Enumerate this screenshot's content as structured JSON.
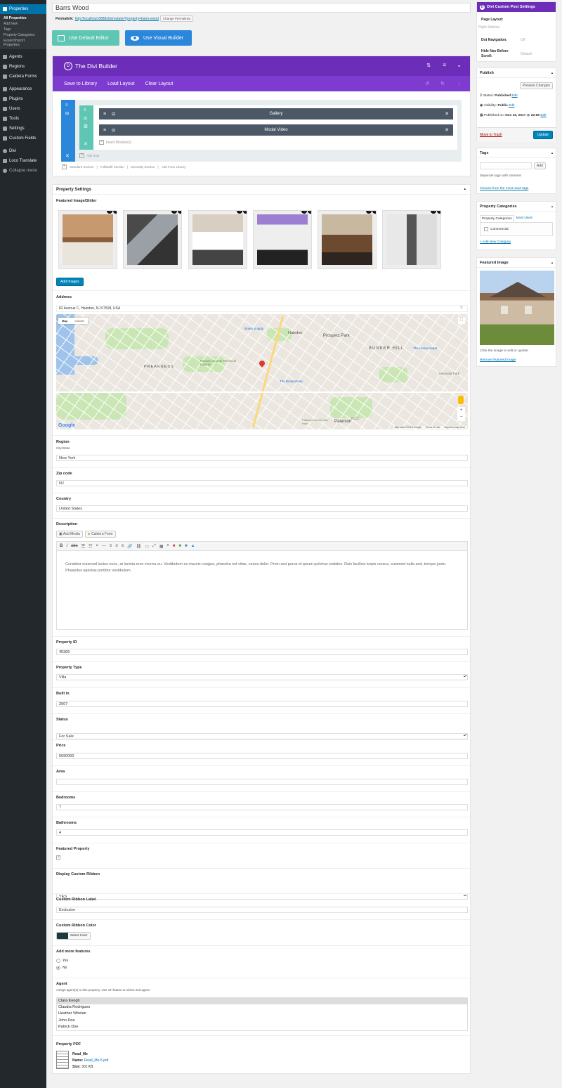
{
  "sidebar": {
    "items": [
      {
        "label": "Properties",
        "icon": "home-icon"
      },
      {
        "label": "Agents",
        "icon": "user-icon"
      },
      {
        "label": "Regions",
        "icon": "location-icon"
      },
      {
        "label": "Caldera Forms",
        "icon": "form-icon"
      },
      {
        "label": "Appearance",
        "icon": "brush-icon"
      },
      {
        "label": "Plugins",
        "icon": "plug-icon"
      },
      {
        "label": "Users",
        "icon": "users-icon"
      },
      {
        "label": "Tools",
        "icon": "wrench-icon"
      },
      {
        "label": "Settings",
        "icon": "settings-icon"
      },
      {
        "label": "Custom Fields",
        "icon": "gear-icon"
      },
      {
        "label": "Divi",
        "icon": "divi-icon"
      },
      {
        "label": "Loco Translate",
        "icon": "translate-icon"
      },
      {
        "label": "Collapse menu",
        "icon": "collapse-icon"
      }
    ],
    "submenu": [
      "All Properties",
      "Add New",
      "Tags",
      "Property Categories",
      "Export/Import Properties"
    ]
  },
  "post": {
    "title": "Barrs Wood",
    "permalink_label": "Permalink:",
    "permalink_url": "http://localhost:8888/divirestate/?property=barrs-wood",
    "change_permalinks": "Change Permalinks"
  },
  "editor_buttons": {
    "default": "Use Default Editor",
    "visual": "Use Visual Builder"
  },
  "divi_builder": {
    "title": "The Divi Builder",
    "actions": [
      "Save to Library",
      "Load Layout",
      "Clear Layout"
    ],
    "modules": [
      "Gallery",
      "Modal Video"
    ],
    "insert_modules": "Insert Module(s)",
    "add_row": "Add Row",
    "section_links": [
      "Standard Section",
      "Fullwidth Section",
      "Specialty Section",
      "Add From Library"
    ]
  },
  "property_settings": {
    "title": "Property Settings",
    "featured_label": "Featured Image/Slider",
    "add_images": "Add Images",
    "address_label": "Address",
    "address_value": "82 Avenue C, Haledon, NJ 07508, USA",
    "map": {
      "map_tab": "Map",
      "satellite_tab": "Satellite",
      "places": [
        "Haledon",
        "Prospect Park",
        "BUNKER HILL",
        "PREAKNESS",
        "Passaic County Technical Institute",
        "The Brownstone",
        "Paterson",
        "Paterson Great Falls Park",
        "The Home Depot",
        "Memorial Park",
        "Braen Supply",
        "PCCC"
      ],
      "footer": [
        "Map data ©2018 Google",
        "Terms of Use",
        "Report a map error"
      ],
      "logo": "Google"
    },
    "region_label": "Region",
    "region_sub": "City/State",
    "region_value": "New York",
    "zip_label": "Zip code",
    "zip_value": "NJ",
    "country_label": "Country",
    "country_value": "United States",
    "description_label": "Description",
    "add_media": "Add Media",
    "caldera_form": "Caldera Form",
    "description_text": "Curabitur euismod luctus nunc, at lacinia eros viverra eu. Vestibulum eu mauris congue, pharetra est vitae, varius dolor. Proin sed purus et ipsum pulvinar sodales. Duis facilisis turpis cursus, euismod nulla sed, tempor justo. Phasellus egestas porttitor vestibulum.",
    "property_id_label": "Property ID",
    "property_id_value": "45366",
    "property_type_label": "Property Type",
    "property_type_value": "Villa",
    "built_label": "Built in",
    "built_value": "2007",
    "status_label": "Status",
    "status_value": "For Sale",
    "price_label": "Price",
    "price_value": "5690000",
    "area_label": "Area",
    "area_value": "",
    "bedrooms_label": "Bedrooms",
    "bedrooms_value": "7",
    "bathrooms_label": "Bathrooms",
    "bathrooms_value": "4",
    "featured_property_label": "Featured Property",
    "featured_property_checked": true,
    "ribbon_label": "Display Custom Ribbon",
    "ribbon_value": "YES",
    "ribbon_text_label": "Custom Ribbon Label",
    "ribbon_text_value": "Exclusive",
    "ribbon_color_label": "Custom Ribbon Color",
    "ribbon_color": "#1d3a3a",
    "select_color": "Select Color",
    "more_features_label": "Add more features",
    "more_features_options": [
      "Yes",
      "No"
    ],
    "more_features_selected": "No",
    "agent_label": "Agent",
    "agent_hint": "Assign agent(s) to this property. Use ctrl button to select 2nd agent.",
    "agents": [
      "Clara Keogh",
      "Claudia Rodrigues",
      "Heather Whelan",
      "John Doe",
      "Patrick Doe"
    ],
    "agent_selected": "Clara Keogh",
    "pdf_label": "Property PDF",
    "pdf_title": "Read_Me",
    "pdf_name_label": "Name:",
    "pdf_name": "Read_Me-5.pdf",
    "pdf_size_label": "Size:",
    "pdf_size": "301 KB"
  },
  "divi_settings": {
    "title": "Divi Custom Post Settings",
    "page_layout_label": "Page Layout:",
    "page_layout_value": "Right Sidebar",
    "dot_nav_label": "Dot Navigation:",
    "dot_nav_value": "Off",
    "hide_nav_label": "Hide Nav Before Scroll:",
    "hide_nav_value": "Default"
  },
  "publish": {
    "title": "Publish",
    "preview": "Preview Changes",
    "status_label": "Status:",
    "status_value": "Published",
    "edit": "Edit",
    "visibility_label": "Visibility:",
    "visibility_value": "Public",
    "published_label": "Published on:",
    "published_value": "Nov 22, 2017 @ 20:56",
    "trash": "Move to Trash",
    "update": "Update"
  },
  "tags": {
    "title": "Tags",
    "add": "Add",
    "hint": "Separate tags with commas",
    "choose": "Choose from the most used tags"
  },
  "categories": {
    "title": "Property Categories",
    "tab_all": "Property Categories",
    "tab_used": "Most Used",
    "items": [
      "Commercial"
    ],
    "add_new": "+ Add New Category"
  },
  "featured_image": {
    "title": "Featured Image",
    "hint": "Click the image to edit or update",
    "remove": "Remove featured image"
  },
  "colors": {
    "divi_purple": "#6c2eb9",
    "divi_purple_light": "#7e3bd0",
    "wp_blue": "#0073aa",
    "teal": "#5fc6b4",
    "builder_blue": "#2b87da"
  }
}
